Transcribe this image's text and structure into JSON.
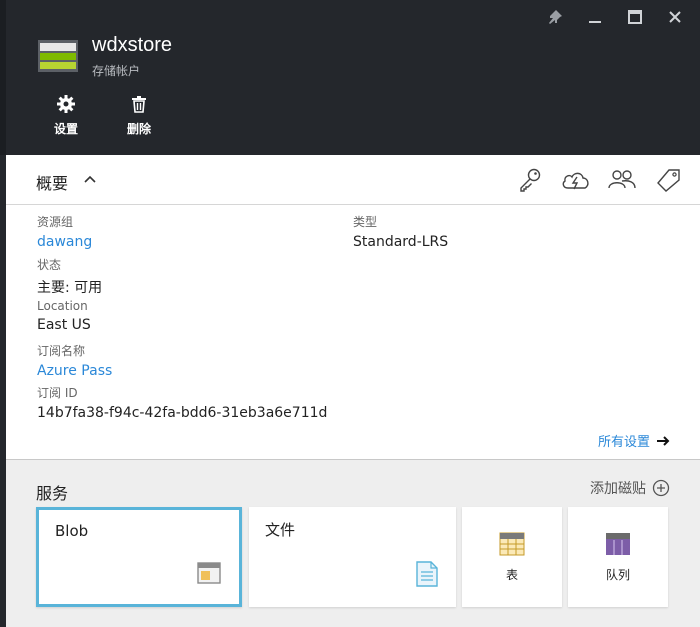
{
  "header": {
    "title": "wdxstore",
    "subtitle": "存储帐户",
    "commands": [
      {
        "label": "设置",
        "icon": "gear-icon"
      },
      {
        "label": "删除",
        "icon": "trash-icon"
      }
    ],
    "window_controls": [
      "pin-icon",
      "minimize-icon",
      "maximize-icon",
      "close-icon"
    ]
  },
  "overview": {
    "title": "概要",
    "toolbar_icons": [
      "key-icon",
      "cloud-lightning-icon",
      "users-icon",
      "tag-icon"
    ],
    "essentials": {
      "resource_group_label": "资源组",
      "resource_group_value": "dawang",
      "status_label": "状态",
      "status_value": "主要: 可用",
      "location_label": "Location",
      "location_value": "East US",
      "subscription_name_label": "订阅名称",
      "subscription_name_value": "Azure Pass",
      "subscription_id_label": "订阅 ID",
      "subscription_id_value": "14b7fa38-f94c-42fa-bdd6-31eb3a6e711d",
      "type_label": "类型",
      "type_value": "Standard-LRS"
    },
    "all_settings": "所有设置"
  },
  "services": {
    "title": "服务",
    "add_tile": "添加磁贴",
    "tiles": [
      {
        "label": "Blob",
        "icon": "blob-container-icon"
      },
      {
        "label": "文件",
        "icon": "file-icon"
      },
      {
        "label": "表",
        "icon": "table-icon"
      },
      {
        "label": "队列",
        "icon": "queue-icon"
      }
    ]
  },
  "colors": {
    "header_bg": "#24272c",
    "link": "#2b88d8",
    "selected_border": "#59b4d9",
    "services_bg": "#eeeeee"
  }
}
